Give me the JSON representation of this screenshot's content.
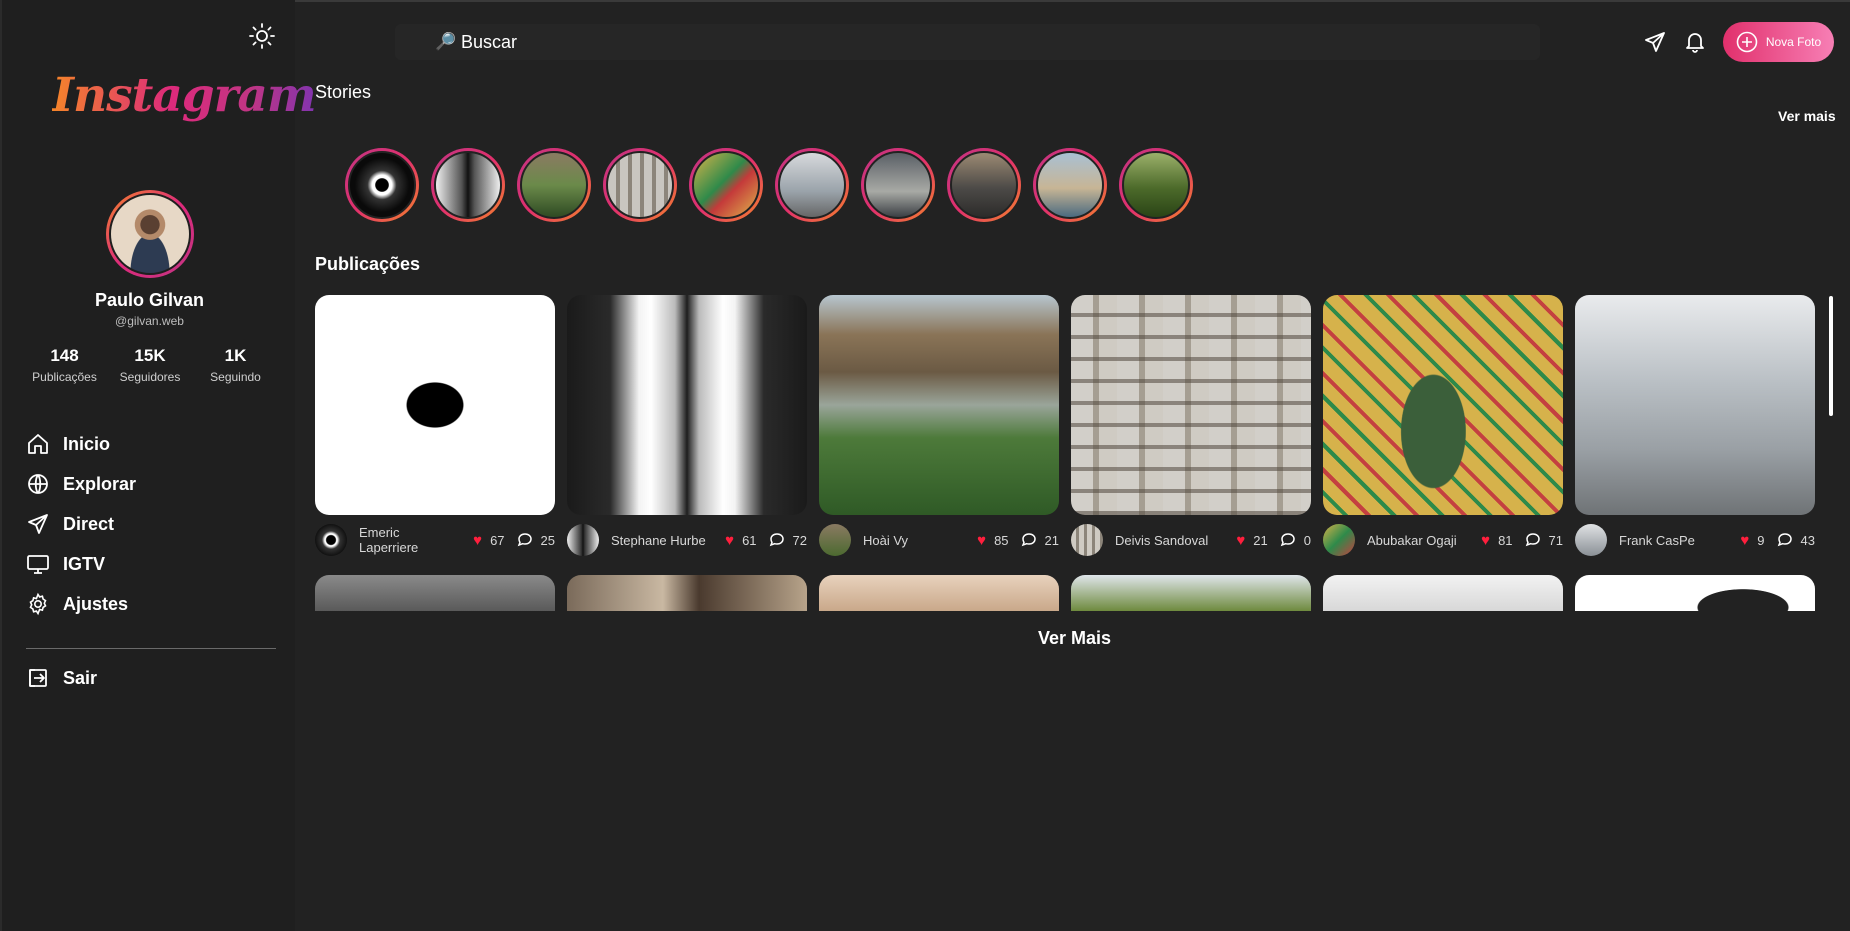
{
  "brand": {
    "logo_text": "Instagram"
  },
  "profile": {
    "name": "Paulo Gilvan",
    "handle": "@gilvan.web",
    "stats": [
      {
        "value": "148",
        "label": "Publicações"
      },
      {
        "value": "15K",
        "label": "Seguidores"
      },
      {
        "value": "1K",
        "label": "Seguindo"
      }
    ]
  },
  "nav": {
    "items": [
      {
        "label": "Inicio",
        "icon": "home-icon"
      },
      {
        "label": "Explorar",
        "icon": "globe-icon"
      },
      {
        "label": "Direct",
        "icon": "send-icon"
      },
      {
        "label": "IGTV",
        "icon": "tv-icon"
      },
      {
        "label": "Ajustes",
        "icon": "gear-icon"
      }
    ],
    "logout": "Sair"
  },
  "header": {
    "search_placeholder": "Buscar",
    "new_photo_label": "Nova Foto"
  },
  "stories": {
    "title": "Stories",
    "see_more": "Ver mais",
    "count": 10
  },
  "posts": {
    "title": "Publicações",
    "see_more": "Ver Mais",
    "items": [
      {
        "author": "Emeric Laperriere",
        "likes": "67",
        "comments": "25"
      },
      {
        "author": "Stephane Hurbe",
        "likes": "61",
        "comments": "72"
      },
      {
        "author": "Hoài Vy",
        "likes": "85",
        "comments": "21"
      },
      {
        "author": "Deivis Sandoval",
        "likes": "21",
        "comments": "0"
      },
      {
        "author": "Abubakar Ogaji",
        "likes": "81",
        "comments": "71"
      },
      {
        "author": "Frank CasPe",
        "likes": "9",
        "comments": "43"
      }
    ]
  },
  "colors": {
    "background": "#222222",
    "sidebar": "#1f1f1f",
    "accent": "#e1306c",
    "heart": "#ff1f3d"
  }
}
